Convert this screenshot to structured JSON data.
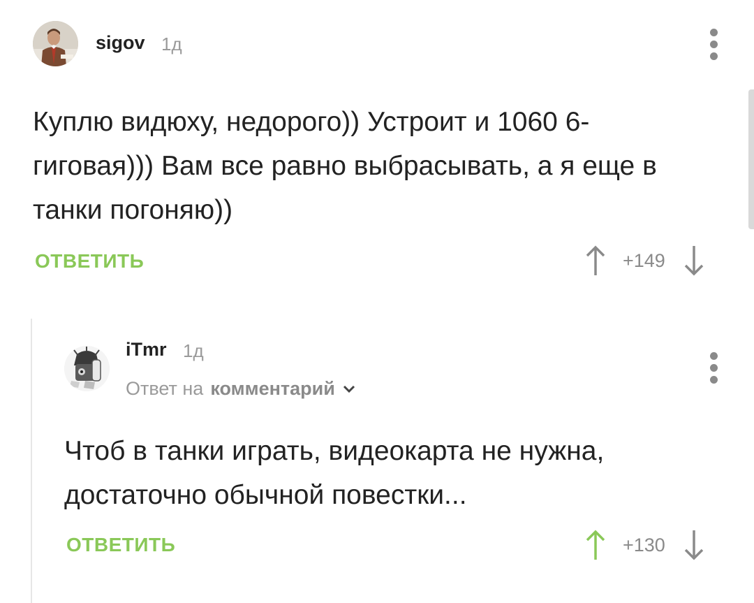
{
  "comments": [
    {
      "author": "sigov",
      "age": "1д",
      "text": "Куплю видюху, недорого)) Устроит и 1060 6-гиговая))) Вам все равно выбрасывать, а я еще в танки погоняю))",
      "reply_label": "ОТВЕТИТЬ",
      "score": "+149",
      "upvoted": false,
      "avatar_icon": "user-avatar-man-suit"
    },
    {
      "author": "iTmr",
      "age": "1д",
      "reply_to_prefix": "Ответ на",
      "reply_to_link": "комментарий",
      "text": "Чтоб в танки играть, видеокарта не нужна, достаточно обычной повестки...",
      "reply_label": "ОТВЕТИТЬ",
      "score": "+130",
      "upvoted": true,
      "avatar_icon": "user-avatar-robot"
    }
  ],
  "colors": {
    "accent_green": "#8ac858",
    "muted_gray": "#8a8a8a",
    "text_dark": "#222222"
  }
}
